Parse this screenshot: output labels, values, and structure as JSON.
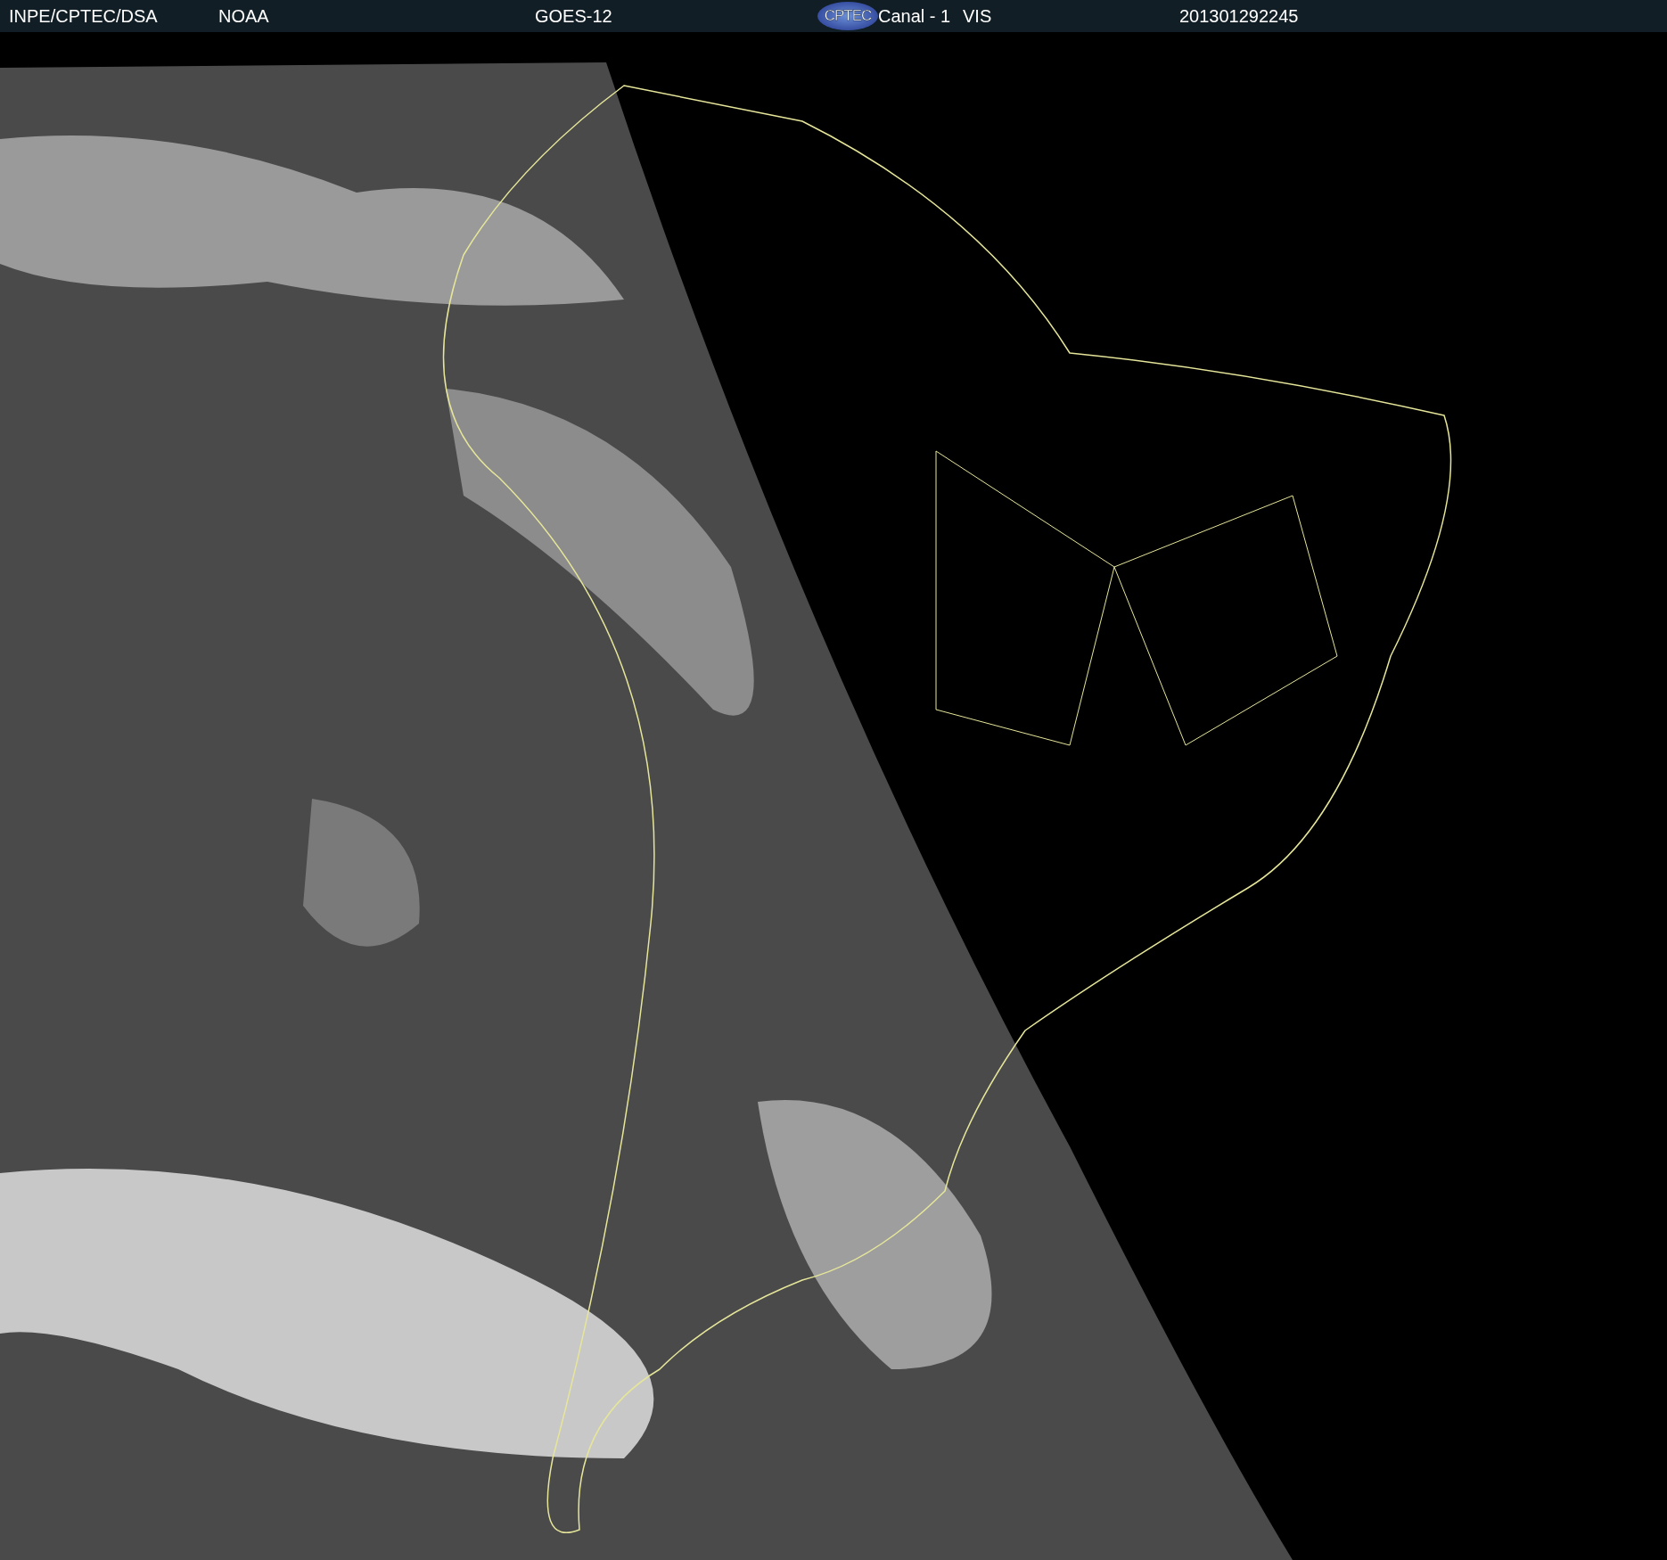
{
  "header": {
    "items": [
      {
        "kind": "text",
        "text": "INPE/CPTEC/DSA"
      },
      {
        "kind": "text",
        "text": "NOAA"
      },
      {
        "kind": "text",
        "text": "GOES-12"
      },
      {
        "kind": "logo",
        "text": "CPTEC"
      },
      {
        "kind": "text",
        "text": "Canal - 1"
      },
      {
        "kind": "text",
        "text": "VIS"
      },
      {
        "kind": "text",
        "text": "201301292245"
      }
    ]
  }
}
